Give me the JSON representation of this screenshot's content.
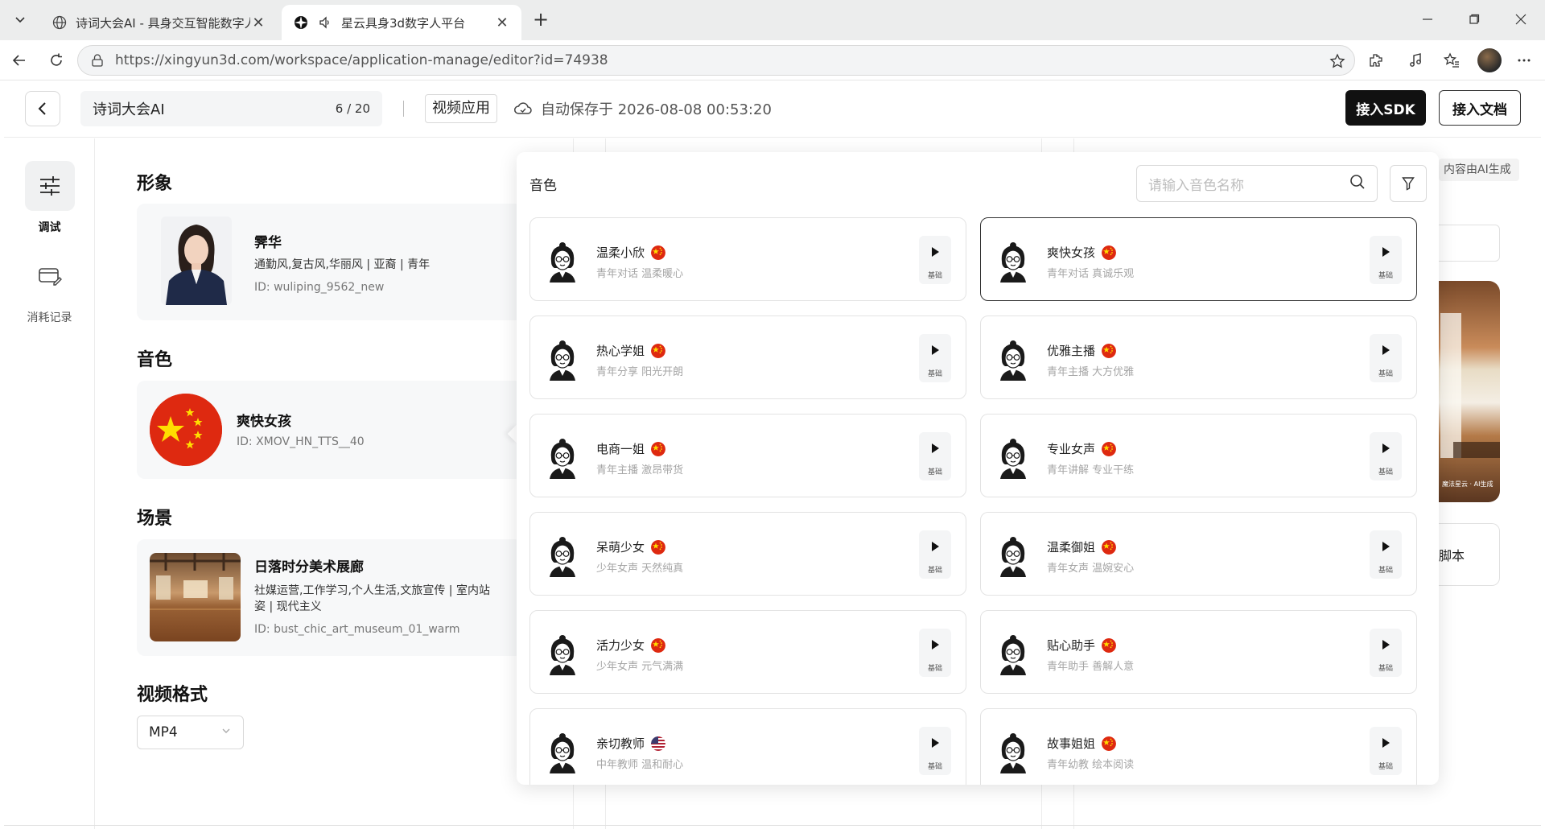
{
  "browser": {
    "tabs": [
      {
        "title": "诗词大会AI - 具身交互智能数字人",
        "active": false
      },
      {
        "title": "星云具身3d数字人平台",
        "active": true
      }
    ],
    "url": "https://xingyun3d.com/workspace/application-manage/editor?id=74938"
  },
  "header": {
    "app_name": "诗词大会AI",
    "name_count": "6 / 20",
    "app_type": "视频应用",
    "autosave": "自动保存于 2026-08-08 00:53:20",
    "sdk_button": "接入SDK",
    "doc_button": "接入文档"
  },
  "rail": {
    "items": [
      {
        "label": "调试",
        "icon": "sliders-icon",
        "active": true
      },
      {
        "label": "消耗记录",
        "icon": "card-edit-icon",
        "active": false
      }
    ]
  },
  "config": {
    "avatar_section": {
      "title": "形象",
      "name": "霁华",
      "tags": "通勤风,复古风,华丽风 | 亚裔 | 青年",
      "id": "ID: wuliping_9562_new"
    },
    "voice_section": {
      "title": "音色",
      "name": "爽快女孩",
      "id": "ID: XMOV_HN_TTS__40"
    },
    "scene_section": {
      "title": "场景",
      "name": "日落时分美术展廊",
      "tags": "社媒运营,工作学习,个人生活,文旅宣传 | 室内站姿 | 现代主义",
      "id": "ID: bust_chic_art_museum_01_warm"
    },
    "format_section": {
      "title": "视频格式",
      "value": "MP4"
    }
  },
  "preview": {
    "ai_note": "内容由AI生成",
    "script_label": "脚本",
    "watermark": "魔法星云 · AI生成"
  },
  "voice_popup": {
    "title": "音色",
    "search_placeholder": "请输入音色名称",
    "tier_label": "基础",
    "voices": [
      {
        "name": "温柔小欣",
        "desc": "青年对话 温柔暖心",
        "flag": "cn",
        "selected": false
      },
      {
        "name": "爽快女孩",
        "desc": "青年对话 真诚乐观",
        "flag": "cn",
        "selected": true
      },
      {
        "name": "热心学姐",
        "desc": "青年分享 阳光开朗",
        "flag": "cn",
        "selected": false
      },
      {
        "name": "优雅主播",
        "desc": "青年主播 大方优雅",
        "flag": "cn",
        "selected": false
      },
      {
        "name": "电商一姐",
        "desc": "青年主播 激昂带货",
        "flag": "cn",
        "selected": false
      },
      {
        "name": "专业女声",
        "desc": "青年讲解 专业干练",
        "flag": "cn",
        "selected": false
      },
      {
        "name": "呆萌少女",
        "desc": "少年女声 天然纯真",
        "flag": "cn",
        "selected": false
      },
      {
        "name": "温柔御姐",
        "desc": "青年女声 温婉安心",
        "flag": "cn",
        "selected": false
      },
      {
        "name": "活力少女",
        "desc": "少年女声 元气满满",
        "flag": "cn",
        "selected": false
      },
      {
        "name": "贴心助手",
        "desc": "青年助手 善解人意",
        "flag": "cn",
        "selected": false
      },
      {
        "name": "亲切教师",
        "desc": "中年教师 温和耐心",
        "flag": "us",
        "selected": false
      },
      {
        "name": "故事姐姐",
        "desc": "青年幼教 绘本阅读",
        "flag": "cn",
        "selected": false
      }
    ]
  },
  "colors": {
    "primary_button": "#111111",
    "china_red": "#de2910",
    "china_yellow": "#ffde00",
    "page_bg": "#ffffff",
    "card_bg": "#f7f8f9"
  }
}
